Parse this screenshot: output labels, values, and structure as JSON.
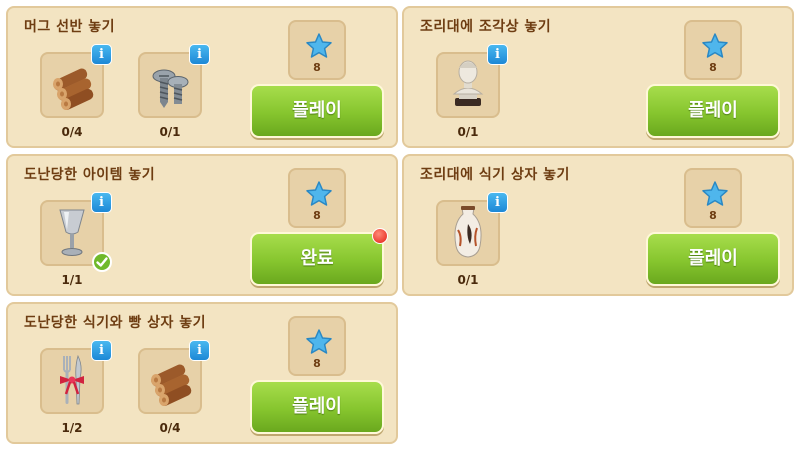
{
  "quests": [
    {
      "title": "머그 선반 놓기",
      "items": [
        {
          "icon": "firewood-icon",
          "count": "0/4"
        },
        {
          "icon": "screws-icon",
          "count": "0/1"
        }
      ],
      "reward": "8",
      "button": "플레이"
    },
    {
      "title": "조리대에 조각상 놓기",
      "items": [
        {
          "icon": "statue-bust-icon",
          "count": "0/1"
        }
      ],
      "reward": "8",
      "button": "플레이"
    },
    {
      "title": "도난당한 아이템 놓기",
      "items": [
        {
          "icon": "goblet-icon",
          "count": "1/1",
          "done": true
        }
      ],
      "reward": "8",
      "button": "완료",
      "notification": true
    },
    {
      "title": "조리대에 식기 상자 놓기",
      "items": [
        {
          "icon": "vase-icon",
          "count": "0/1"
        }
      ],
      "reward": "8",
      "button": "플레이"
    },
    {
      "title": "도난당한 식기와 빵 상자 놓기",
      "items": [
        {
          "icon": "cutlery-bow-icon",
          "count": "1/2"
        },
        {
          "icon": "firewood-icon",
          "count": "0/4"
        }
      ],
      "reward": "8",
      "button": "플레이"
    }
  ],
  "colors": {
    "card_bg": "#f3e4c2",
    "button_green": "#86c52e",
    "info_blue": "#1d88d6",
    "star_blue": "#3fa9e6"
  }
}
